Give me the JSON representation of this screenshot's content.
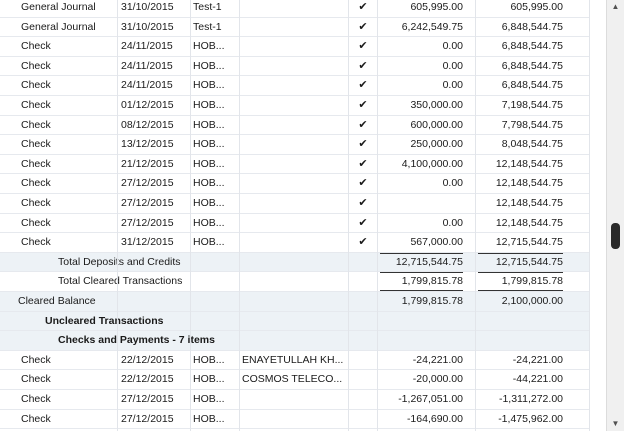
{
  "cleared_rows": [
    {
      "type": "General Journal",
      "date": "31/10/2015",
      "num": "Test-1",
      "name": "",
      "clr": "✔",
      "amount": "605,995.00",
      "balance": "605,995.00"
    },
    {
      "type": "General Journal",
      "date": "31/10/2015",
      "num": "Test-1",
      "name": "",
      "clr": "✔",
      "amount": "6,242,549.75",
      "balance": "6,848,544.75"
    },
    {
      "type": "Check",
      "date": "24/11/2015",
      "num": "HOB...",
      "name": "",
      "clr": "✔",
      "amount": "0.00",
      "balance": "6,848,544.75"
    },
    {
      "type": "Check",
      "date": "24/11/2015",
      "num": "HOB...",
      "name": "",
      "clr": "✔",
      "amount": "0.00",
      "balance": "6,848,544.75"
    },
    {
      "type": "Check",
      "date": "24/11/2015",
      "num": "HOB...",
      "name": "",
      "clr": "✔",
      "amount": "0.00",
      "balance": "6,848,544.75"
    },
    {
      "type": "Check",
      "date": "01/12/2015",
      "num": "HOB...",
      "name": "",
      "clr": "✔",
      "amount": "350,000.00",
      "balance": "7,198,544.75"
    },
    {
      "type": "Check",
      "date": "08/12/2015",
      "num": "HOB...",
      "name": "",
      "clr": "✔",
      "amount": "600,000.00",
      "balance": "7,798,544.75"
    },
    {
      "type": "Check",
      "date": "13/12/2015",
      "num": "HOB...",
      "name": "",
      "clr": "✔",
      "amount": "250,000.00",
      "balance": "8,048,544.75"
    },
    {
      "type": "Check",
      "date": "21/12/2015",
      "num": "HOB...",
      "name": "",
      "clr": "✔",
      "amount": "4,100,000.00",
      "balance": "12,148,544.75"
    },
    {
      "type": "Check",
      "date": "27/12/2015",
      "num": "HOB...",
      "name": "",
      "clr": "✔",
      "amount": "0.00",
      "balance": "12,148,544.75"
    },
    {
      "type": "Check",
      "date": "27/12/2015",
      "num": "HOB...",
      "name": "",
      "clr": "✔",
      "amount": "",
      "balance": "12,148,544.75"
    },
    {
      "type": "Check",
      "date": "27/12/2015",
      "num": "HOB...",
      "name": "",
      "clr": "✔",
      "amount": "0.00",
      "balance": "12,148,544.75"
    },
    {
      "type": "Check",
      "date": "31/12/2015",
      "num": "HOB...",
      "name": "",
      "clr": "✔",
      "amount": "567,000.00",
      "balance": "12,715,544.75"
    }
  ],
  "total_deposits": {
    "label": "Total Deposits and Credits",
    "amount": "12,715,544.75",
    "balance": "12,715,544.75"
  },
  "total_cleared": {
    "label": "Total Cleared Transactions",
    "amount": "1,799,815.78",
    "balance": "1,799,815.78"
  },
  "cleared_balance": {
    "label": "Cleared Balance",
    "amount": "1,799,815.78",
    "balance": "2,100,000.00"
  },
  "uncleared_heading": "Uncleared Transactions",
  "checks_heading": "Checks and Payments - 7 items",
  "uncleared_rows": [
    {
      "type": "Check",
      "date": "22/12/2015",
      "num": "HOB...",
      "name": "ENAYETULLAH KH...",
      "clr": "",
      "amount": "-24,221.00",
      "balance": "-24,221.00"
    },
    {
      "type": "Check",
      "date": "22/12/2015",
      "num": "HOB...",
      "name": "COSMOS TELECO...",
      "clr": "",
      "amount": "-20,000.00",
      "balance": "-44,221.00"
    },
    {
      "type": "Check",
      "date": "27/12/2015",
      "num": "HOB...",
      "name": "",
      "clr": "",
      "amount": "-1,267,051.00",
      "balance": "-1,311,272.00"
    },
    {
      "type": "Check",
      "date": "27/12/2015",
      "num": "HOB...",
      "name": "",
      "clr": "",
      "amount": "-164,690.00",
      "balance": "-1,475,962.00"
    }
  ],
  "scrollbar": {
    "up_icon": "▲",
    "down_icon": "▼"
  }
}
